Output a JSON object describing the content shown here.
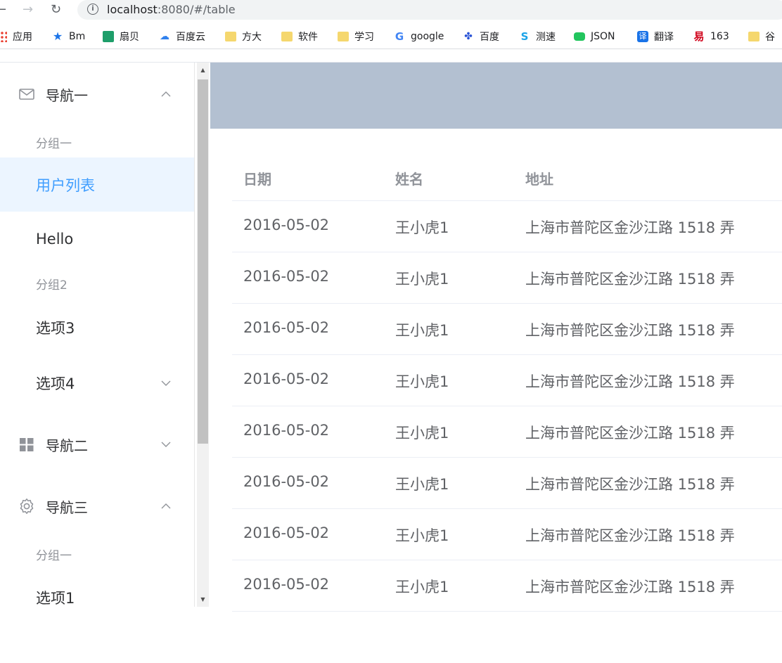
{
  "browser": {
    "url_host": "localhost",
    "url_rest": ":8080/#/table",
    "bookmarks": [
      "应用",
      "Bm",
      "扇贝",
      "百度云",
      "方大",
      "软件",
      "学习",
      "google",
      "百度",
      "测速",
      "JSON",
      "翻译",
      "163",
      "谷"
    ]
  },
  "sidebar": {
    "nav1": {
      "label": "导航一",
      "group1": "分组一",
      "item_active": "用户列表",
      "item_hello": "Hello",
      "group2": "分组2",
      "item3": "选项3",
      "item4": "选项4"
    },
    "nav2": {
      "label": "导航二"
    },
    "nav3": {
      "label": "导航三",
      "group1": "分组一",
      "item1": "选项1"
    }
  },
  "table": {
    "headers": [
      "日期",
      "姓名",
      "地址"
    ],
    "rows": [
      [
        "2016-05-02",
        "王小虎1",
        "上海市普陀区金沙江路 1518 弄"
      ],
      [
        "2016-05-02",
        "王小虎1",
        "上海市普陀区金沙江路 1518 弄"
      ],
      [
        "2016-05-02",
        "王小虎1",
        "上海市普陀区金沙江路 1518 弄"
      ],
      [
        "2016-05-02",
        "王小虎1",
        "上海市普陀区金沙江路 1518 弄"
      ],
      [
        "2016-05-02",
        "王小虎1",
        "上海市普陀区金沙江路 1518 弄"
      ],
      [
        "2016-05-02",
        "王小虎1",
        "上海市普陀区金沙江路 1518 弄"
      ],
      [
        "2016-05-02",
        "王小虎1",
        "上海市普陀区金沙江路 1518 弄"
      ],
      [
        "2016-05-02",
        "王小虎1",
        "上海市普陀区金沙江路 1518 弄"
      ]
    ]
  },
  "colors": {
    "accent": "#409eff",
    "active_bg": "#ecf5ff",
    "header_band": "#b3c0d1"
  }
}
